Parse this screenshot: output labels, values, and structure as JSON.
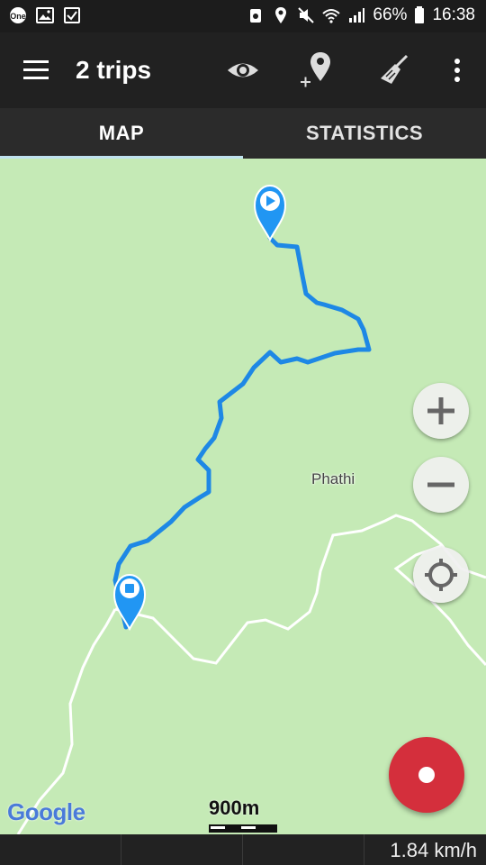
{
  "status_bar": {
    "left_icons": [
      "one-app-icon",
      "gallery-icon",
      "tasks-icon"
    ],
    "right_icons": [
      "recycle-icon",
      "location-icon",
      "mute-icon",
      "wifi-icon",
      "signal-icon"
    ],
    "battery": "66%",
    "time": "16:38"
  },
  "app_bar": {
    "title": "2 trips",
    "actions": [
      "eye-icon",
      "add-marker-icon",
      "broom-icon",
      "more-vert-icon"
    ]
  },
  "tabs": [
    {
      "label": "MAP",
      "selected": true
    },
    {
      "label": "STATISTICS",
      "selected": false
    }
  ],
  "map": {
    "place_label": "Phathi",
    "scale_label": "900m",
    "attribution": "Google",
    "track_color": "#1e88e5",
    "start_marker": "play-marker-icon",
    "end_marker": "stop-marker-icon"
  },
  "controls": {
    "zoom_in": "plus-icon",
    "zoom_out": "minus-icon",
    "my_location": "crosshair-icon",
    "record": "record-icon"
  },
  "bottom_bar": {
    "speed": "1.84 km/h"
  },
  "colors": {
    "map_bg": "#c5eab6",
    "app_bar": "#212121",
    "record": "#d42f3c"
  }
}
